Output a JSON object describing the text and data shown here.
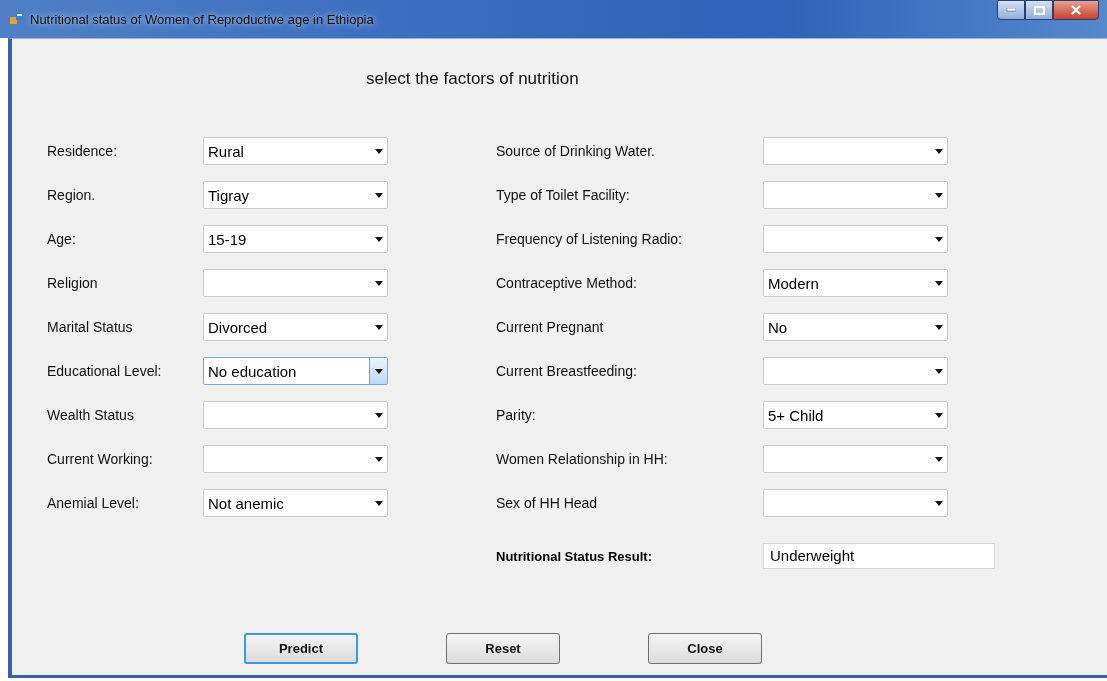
{
  "window": {
    "title": "Nutritional status of Women of Reproductive age in Ethiopia"
  },
  "heading": "select the factors of nutrition",
  "left_fields": [
    {
      "label": "Residence:",
      "value": "Rural",
      "focused": false
    },
    {
      "label": "Region.",
      "value": "Tigray",
      "focused": false
    },
    {
      "label": "Age:",
      "value": "15-19",
      "focused": false
    },
    {
      "label": "Religion",
      "focused": false
    },
    {
      "label": "Marital Status",
      "value": "Divorced",
      "focused": false
    },
    {
      "label": "Educational Level:",
      "value": "No education",
      "focused": true
    },
    {
      "label": "Wealth Status",
      "focused": false
    },
    {
      "label": "Current Working:",
      "focused": false
    },
    {
      "label": "Anemial Level:",
      "value": "Not anemic",
      "focused": false
    }
  ],
  "right_fields": [
    {
      "label": "Source of Drinking Water.",
      "focused": false
    },
    {
      "label": "Type of Toilet Facility:",
      "focused": false
    },
    {
      "label": "Frequency of Listening Radio:",
      "focused": false
    },
    {
      "label": "Contraceptive Method:",
      "value": "Modern",
      "focused": false
    },
    {
      "label": "Current Pregnant",
      "value": "No",
      "focused": false
    },
    {
      "label": "Current Breastfeeding:",
      "focused": false
    },
    {
      "label": "Parity:",
      "value": "5+ Child",
      "focused": false
    },
    {
      "label": "Women Relationship in HH:",
      "focused": false
    },
    {
      "label": "Sex of HH Head",
      "focused": false
    }
  ],
  "result": {
    "label": "Nutritional Status Result:",
    "value": "Underweight"
  },
  "buttons": [
    {
      "label": "Predict",
      "default": true
    },
    {
      "label": "Reset",
      "default": false
    },
    {
      "label": "Close",
      "default": false
    }
  ]
}
